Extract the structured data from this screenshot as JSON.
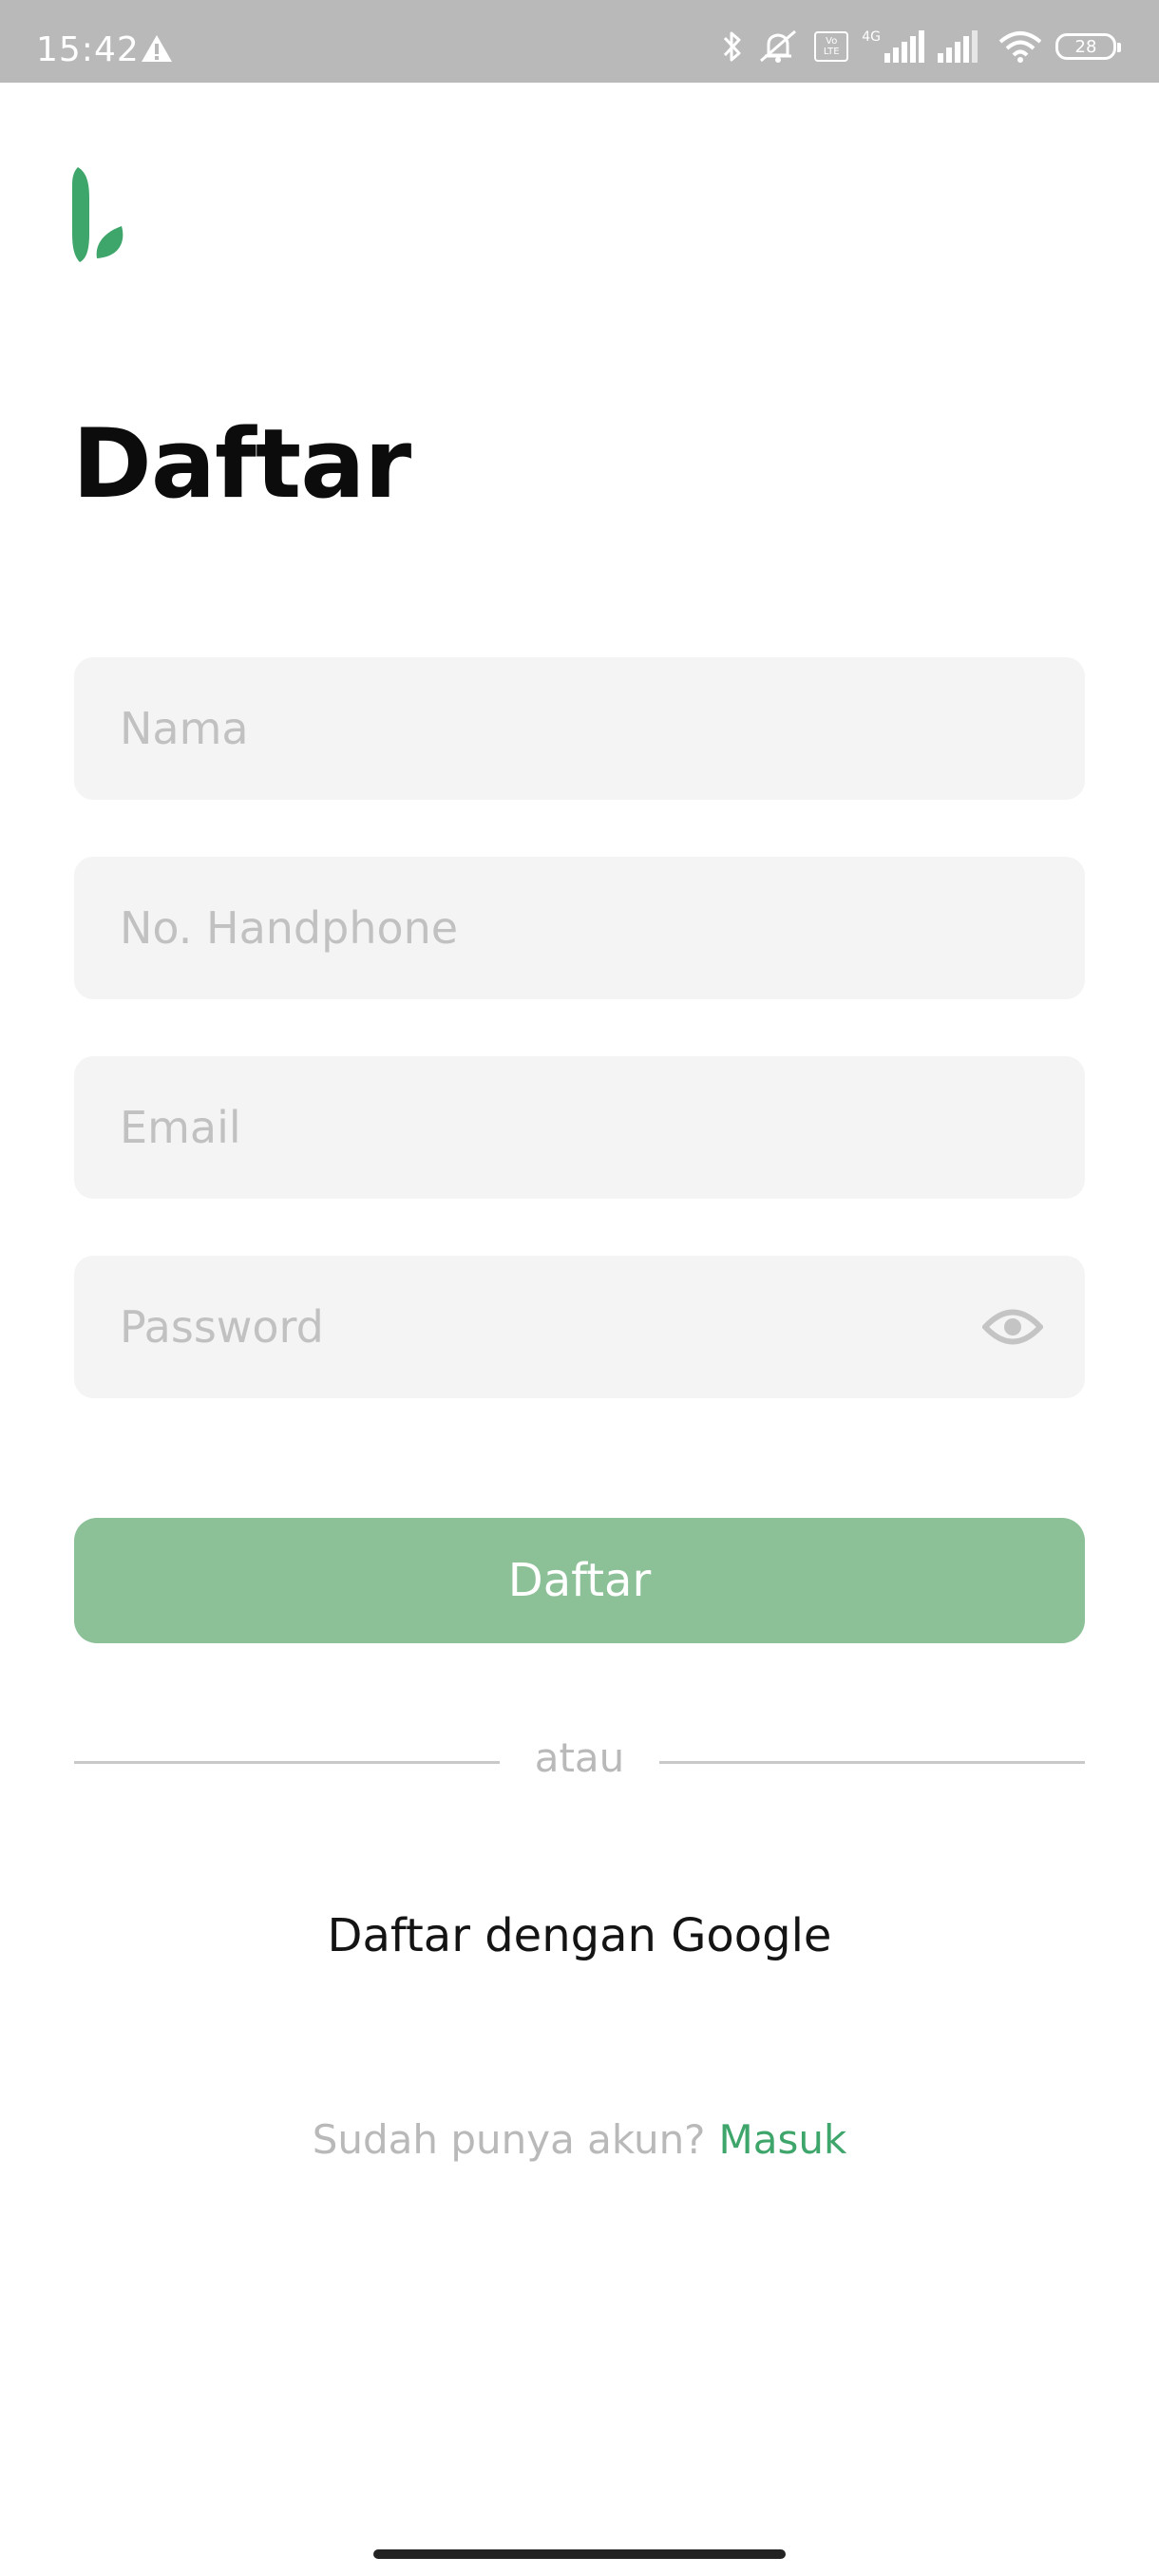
{
  "status_bar": {
    "time": "15:42",
    "network_label": "4G",
    "volte_label": "Vo LTE",
    "battery": "28"
  },
  "page": {
    "title": "Daftar"
  },
  "form": {
    "name_placeholder": "Nama",
    "phone_placeholder": "No. Handphone",
    "email_placeholder": "Email",
    "password_placeholder": "Password",
    "submit_label": "Daftar"
  },
  "divider": {
    "label": "atau"
  },
  "google": {
    "label": "Daftar dengan Google"
  },
  "signin": {
    "prompt": "Sudah punya akun?",
    "link": "Masuk"
  },
  "colors": {
    "brand_green": "#3ea56b",
    "button_green": "#8cc198",
    "field_bg": "#f4f4f4",
    "status_bar": "#b9b9b9"
  },
  "icons": {
    "logo": "brand-leaf-logo",
    "password_toggle": "eye-icon",
    "status": [
      "warning-icon",
      "bluetooth-icon",
      "mute-icon",
      "volte-icon",
      "signal-icon",
      "signal-icon",
      "wifi-icon",
      "battery-icon"
    ]
  }
}
